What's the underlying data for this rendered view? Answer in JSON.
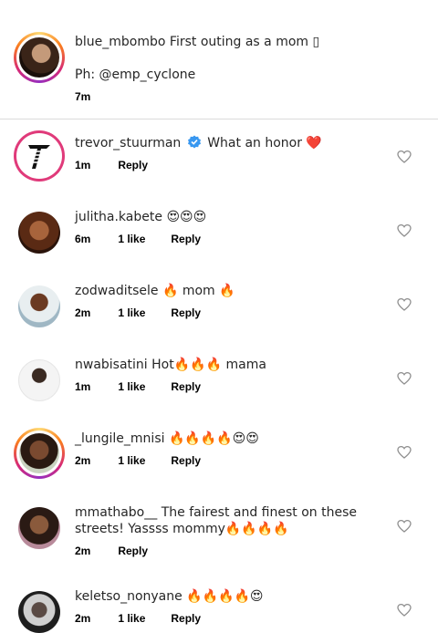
{
  "caption": {
    "username": "blue_mbombo",
    "text": "First outing as a mom ▯",
    "credit": "Ph: @emp_cyclone",
    "time": "7m"
  },
  "comments": [
    {
      "username": "trevor_stuurman",
      "verified": true,
      "text": "What an honor ❤️",
      "time": "1m",
      "likes": "",
      "reply": "Reply"
    },
    {
      "username": "julitha.kabete",
      "text": "😍😍😍",
      "time": "6m",
      "likes": "1 like",
      "reply": "Reply"
    },
    {
      "username": "zodwaditsele",
      "text": "🔥 mom 🔥",
      "time": "2m",
      "likes": "1 like",
      "reply": "Reply"
    },
    {
      "username": "nwabisatini",
      "text": "Hot🔥🔥🔥 mama",
      "time": "1m",
      "likes": "1 like",
      "reply": "Reply"
    },
    {
      "username": "_lungile_mnisi",
      "text": "🔥🔥🔥🔥😍😍",
      "time": "2m",
      "likes": "1 like",
      "reply": "Reply"
    },
    {
      "username": "mmathabo__",
      "text": "The fairest and finest on these",
      "text2": "streets! Yassss mommy🔥🔥🔥🔥",
      "time": "2m",
      "likes": "",
      "reply": "Reply"
    },
    {
      "username": "keletso_nonyane",
      "text": "🔥🔥🔥🔥😍",
      "time": "2m",
      "likes": "1 like",
      "reply": "Reply"
    }
  ],
  "colors": {
    "story_ring": "#d62976",
    "verified": "#3897f0",
    "heart_outline": "#8e8e8e"
  }
}
